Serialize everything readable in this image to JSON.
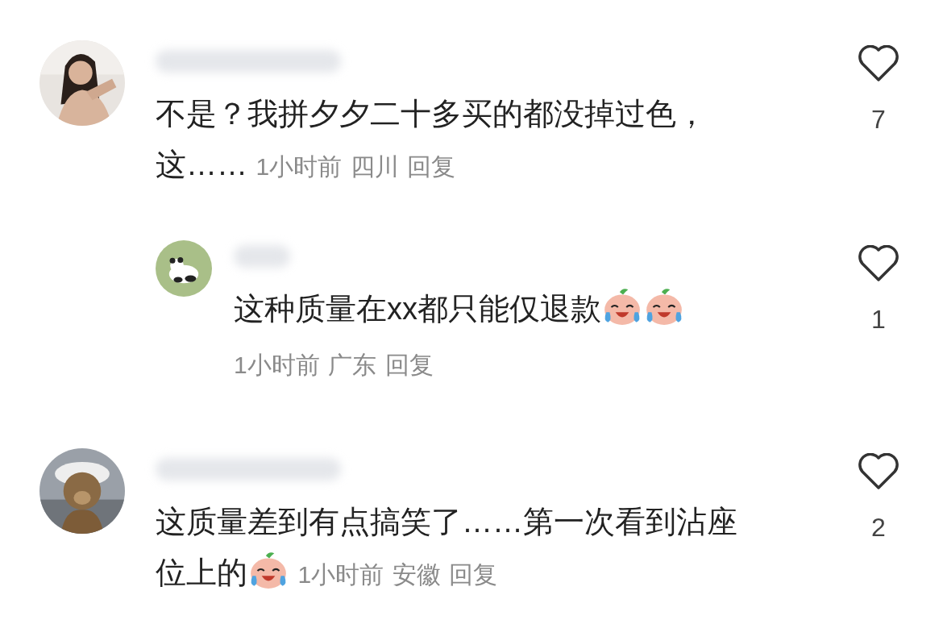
{
  "comments": [
    {
      "parts": [
        {
          "kind": "text",
          "text": "不是？我拼夕夕二十多买的都没掉过色，"
        },
        {
          "kind": "break"
        },
        {
          "kind": "text",
          "text": "这……"
        }
      ],
      "time": "1小时前",
      "location": "四川",
      "reply": "回复",
      "likes": "7",
      "liked": false,
      "indent": false
    },
    {
      "parts": [
        {
          "kind": "text",
          "text": "这种质量在xx都只能仅退款"
        },
        {
          "kind": "emoji"
        },
        {
          "kind": "emoji"
        }
      ],
      "time": "1小时前",
      "location": "广东",
      "reply": "回复",
      "likes": "1",
      "liked": false,
      "indent": true
    },
    {
      "parts": [
        {
          "kind": "text",
          "text": "这质量差到有点搞笑了……第一次看到沾座"
        },
        {
          "kind": "break"
        },
        {
          "kind": "text",
          "text": "位上的"
        },
        {
          "kind": "emoji"
        }
      ],
      "time": "1小时前",
      "location": "安徽",
      "reply": "回复",
      "likes": "2",
      "liked": false,
      "indent": false
    }
  ]
}
